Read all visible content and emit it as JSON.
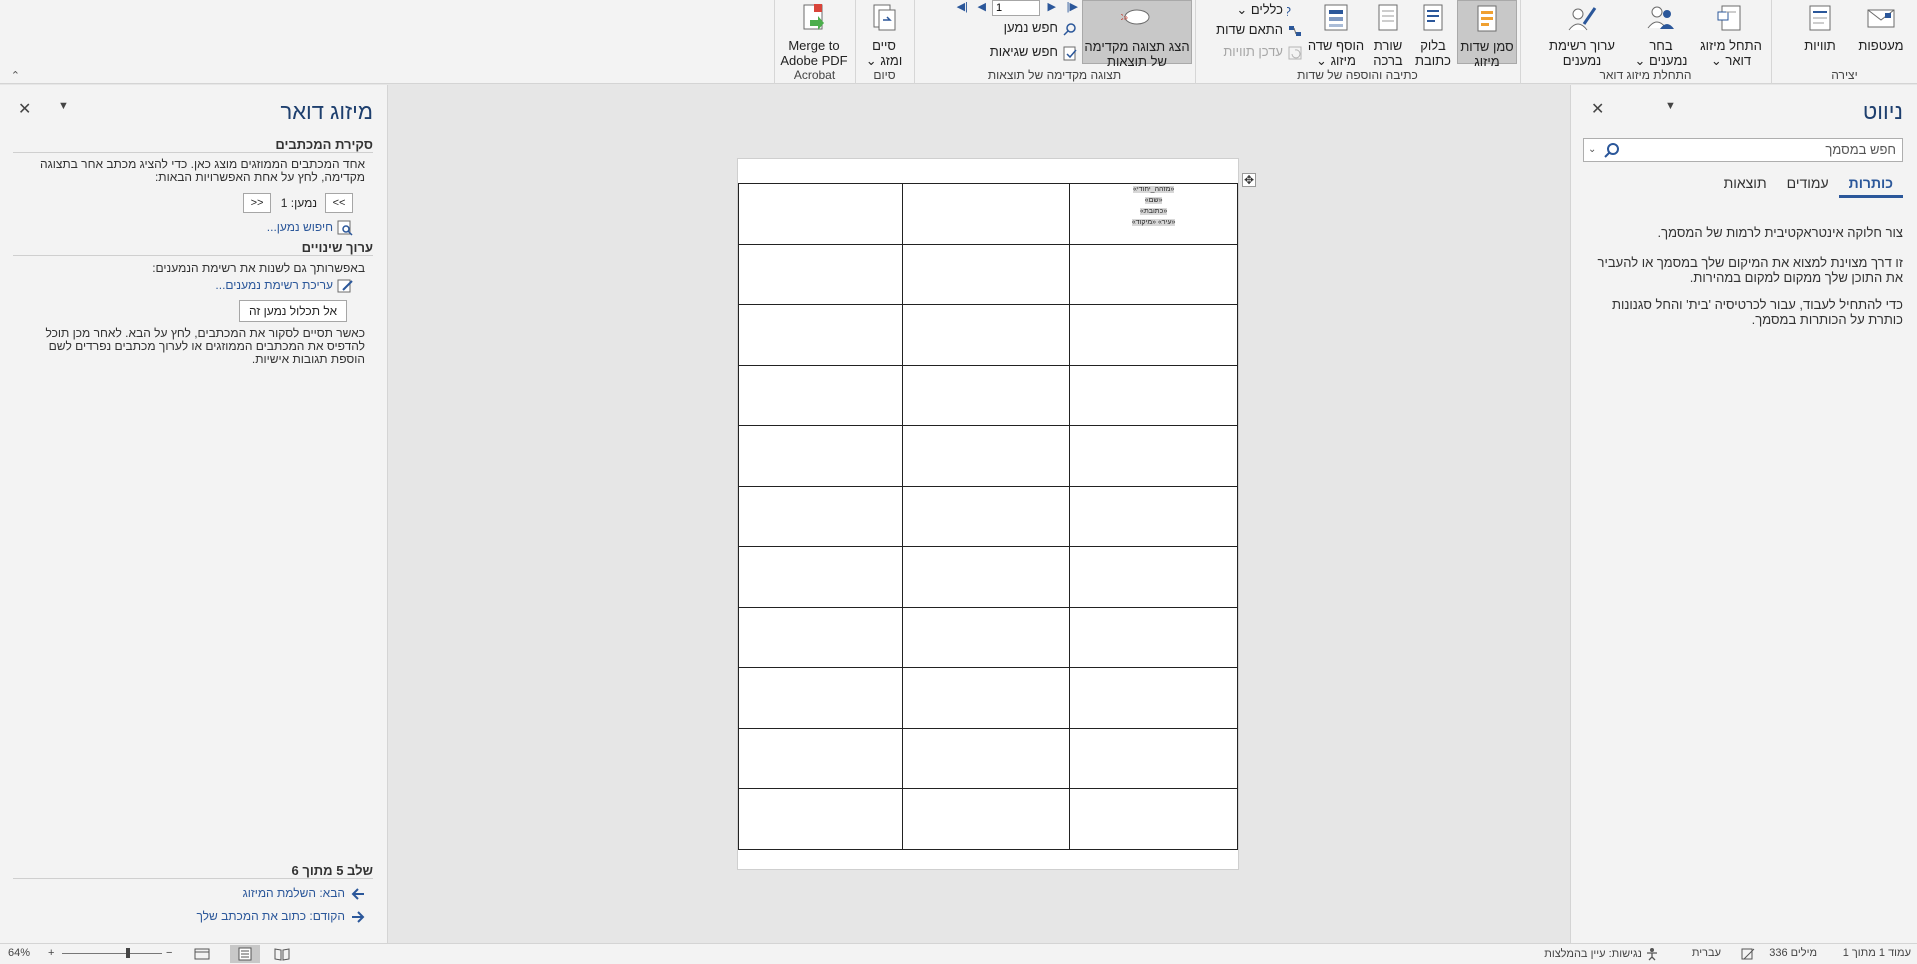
{
  "ribbon": {
    "groups": {
      "create": "יצירה",
      "start_merge": "התחלת מיזוג דואר",
      "write_insert": "כתיבה והוספה של שדות",
      "preview": "תצוגה מקדימה של תוצאות",
      "finish": "סיום",
      "acrobat": "Acrobat"
    },
    "buttons": {
      "envelopes": "מעטפות",
      "labels": "תוויות",
      "start_mail_merge": "התחל מיזוג",
      "start_mail_merge2": "דואר",
      "select_recipients": "בחר",
      "select_recipients2": "נמענים",
      "edit_recipient_list": "ערוך רשימת",
      "edit_recipient_list2": "נמענים",
      "highlight_fields": "סמן שדות",
      "highlight_fields2": "מיזוג",
      "address_block": "בלוק",
      "address_block2": "כתובת",
      "greeting_line": "שורת",
      "greeting_line2": "ברכה",
      "insert_merge_field": "הוסף שדה",
      "insert_merge_field2": "מיזוג",
      "rules": "כללים",
      "match_fields": "התאם שדות",
      "update_labels": "עדכן תוויות",
      "preview_results": "הצג תצוגה מקדימה",
      "preview_results2": "של תוצאות",
      "record_number": "1",
      "find_recipient": "חפש נמען",
      "check_errors": "חפש שגיאות",
      "finish_merge": "סיים",
      "finish_merge2": "ומזג",
      "merge_to_pdf": "Merge to",
      "merge_to_pdf2": "Adobe PDF"
    }
  },
  "nav_pane": {
    "title": "ניווט",
    "search_placeholder": "חפש במסמך",
    "tabs": [
      "כותרות",
      "עמודים",
      "תוצאות"
    ],
    "active_tab": "כותרות",
    "text1": "צור חלוקה אינטראקטיבית לרמות של המסמך.",
    "text2": "זו דרך מצוינת למצוא את המיקום שלך במסמך או להעביר את התוכן שלך ממקום למקום במהירות.",
    "text3": "כדי להתחיל לעבוד, עבור לכרטיסיה 'בית' והחל סגנונות כותרת על הכותרות במסמך."
  },
  "merge_pane": {
    "title": "מיזוג דואר",
    "preview_heading": "סקירת המכתבים",
    "preview_text": "אחד המכתבים הממוזגים מוצג כאן. כדי להציג מכתב אחר בתצוגה מקדימה, לחץ על אחת האפשרויות הבאות:",
    "recipient_label": "נמען: 1",
    "prev_btn": "<<",
    "next_btn": ">>",
    "find_recipient": "חיפוש נמען...",
    "changes_heading": "ערוך שינויים",
    "changes_text": "באפשרותך גם לשנות את רשימת הנמענים:",
    "edit_list": "עריכת רשימת נמענים...",
    "exclude_btn": "אל תכלול נמען זה",
    "finish_text": "כאשר תסיים לסקור את המכתבים, לחץ על הבא. לאחר מכן תוכל להדפיס את המכתבים הממוזגים או לערוך מכתבים נפרדים לשם הוספת תגובות אישיות.",
    "step": "שלב 5 מתוך 6",
    "next_step": "הבא: השלמת המיזוג",
    "prev_step": "הקודם: כתוב את המכתב שלך"
  },
  "document": {
    "merge_fields": [
      "«מזהה_יחודי»",
      "«שם»",
      "«כתובת»",
      "«עיר» «מיקוד»"
    ],
    "rows": 11,
    "cols": 3
  },
  "statusbar": {
    "page": "עמוד 1 מתוך 1",
    "words": "336 מילים",
    "language": "עברית",
    "accessibility": "נגישות: עיין בהמלצות",
    "zoom": "64%",
    "zoom_minus": "−",
    "zoom_plus": "+"
  },
  "colors": {
    "accent": "#2b579a",
    "title": "#1e3f6e",
    "ribbon_bg": "#f3f3f3",
    "canvas_bg": "#e6e6e6"
  }
}
